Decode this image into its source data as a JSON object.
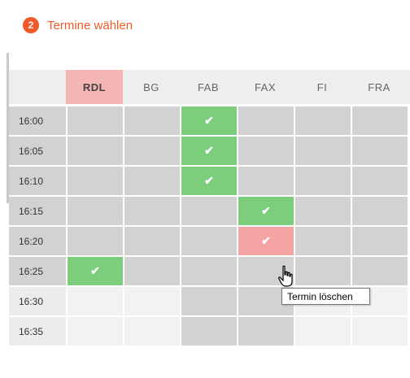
{
  "step": {
    "number": "2",
    "title": "Termine wählen"
  },
  "columns": [
    "RDL",
    "BG",
    "FAB",
    "FAX",
    "FI",
    "FRA"
  ],
  "selected_column": "RDL",
  "rows": [
    {
      "time": "16:00",
      "cells": [
        "g",
        "g",
        "ok",
        "g",
        "g",
        "g"
      ]
    },
    {
      "time": "16:05",
      "cells": [
        "g",
        "g",
        "ok",
        "g",
        "g",
        "g"
      ]
    },
    {
      "time": "16:10",
      "cells": [
        "g",
        "g",
        "ok",
        "g",
        "g",
        "g"
      ]
    },
    {
      "time": "16:15",
      "cells": [
        "g",
        "g",
        "g",
        "ok",
        "g",
        "g"
      ]
    },
    {
      "time": "16:20",
      "cells": [
        "g",
        "g",
        "g",
        "del",
        "g",
        "g"
      ]
    },
    {
      "time": "16:25",
      "cells": [
        "ok",
        "g",
        "g",
        "g",
        "g",
        "g"
      ]
    },
    {
      "time": "16:30",
      "cells": [
        "l",
        "l",
        "g",
        "g",
        "l",
        "l"
      ]
    },
    {
      "time": "16:35",
      "cells": [
        "l",
        "l",
        "g",
        "g",
        "l",
        "l"
      ]
    }
  ],
  "checkmark": "✔",
  "tooltip": "Termin löschen",
  "colors": {
    "accent": "#f05a28",
    "booked": "#7ccd7c",
    "delete": "#f5a4a4",
    "available": "#d2d2d2",
    "unavailable": "#f2f2f2"
  }
}
